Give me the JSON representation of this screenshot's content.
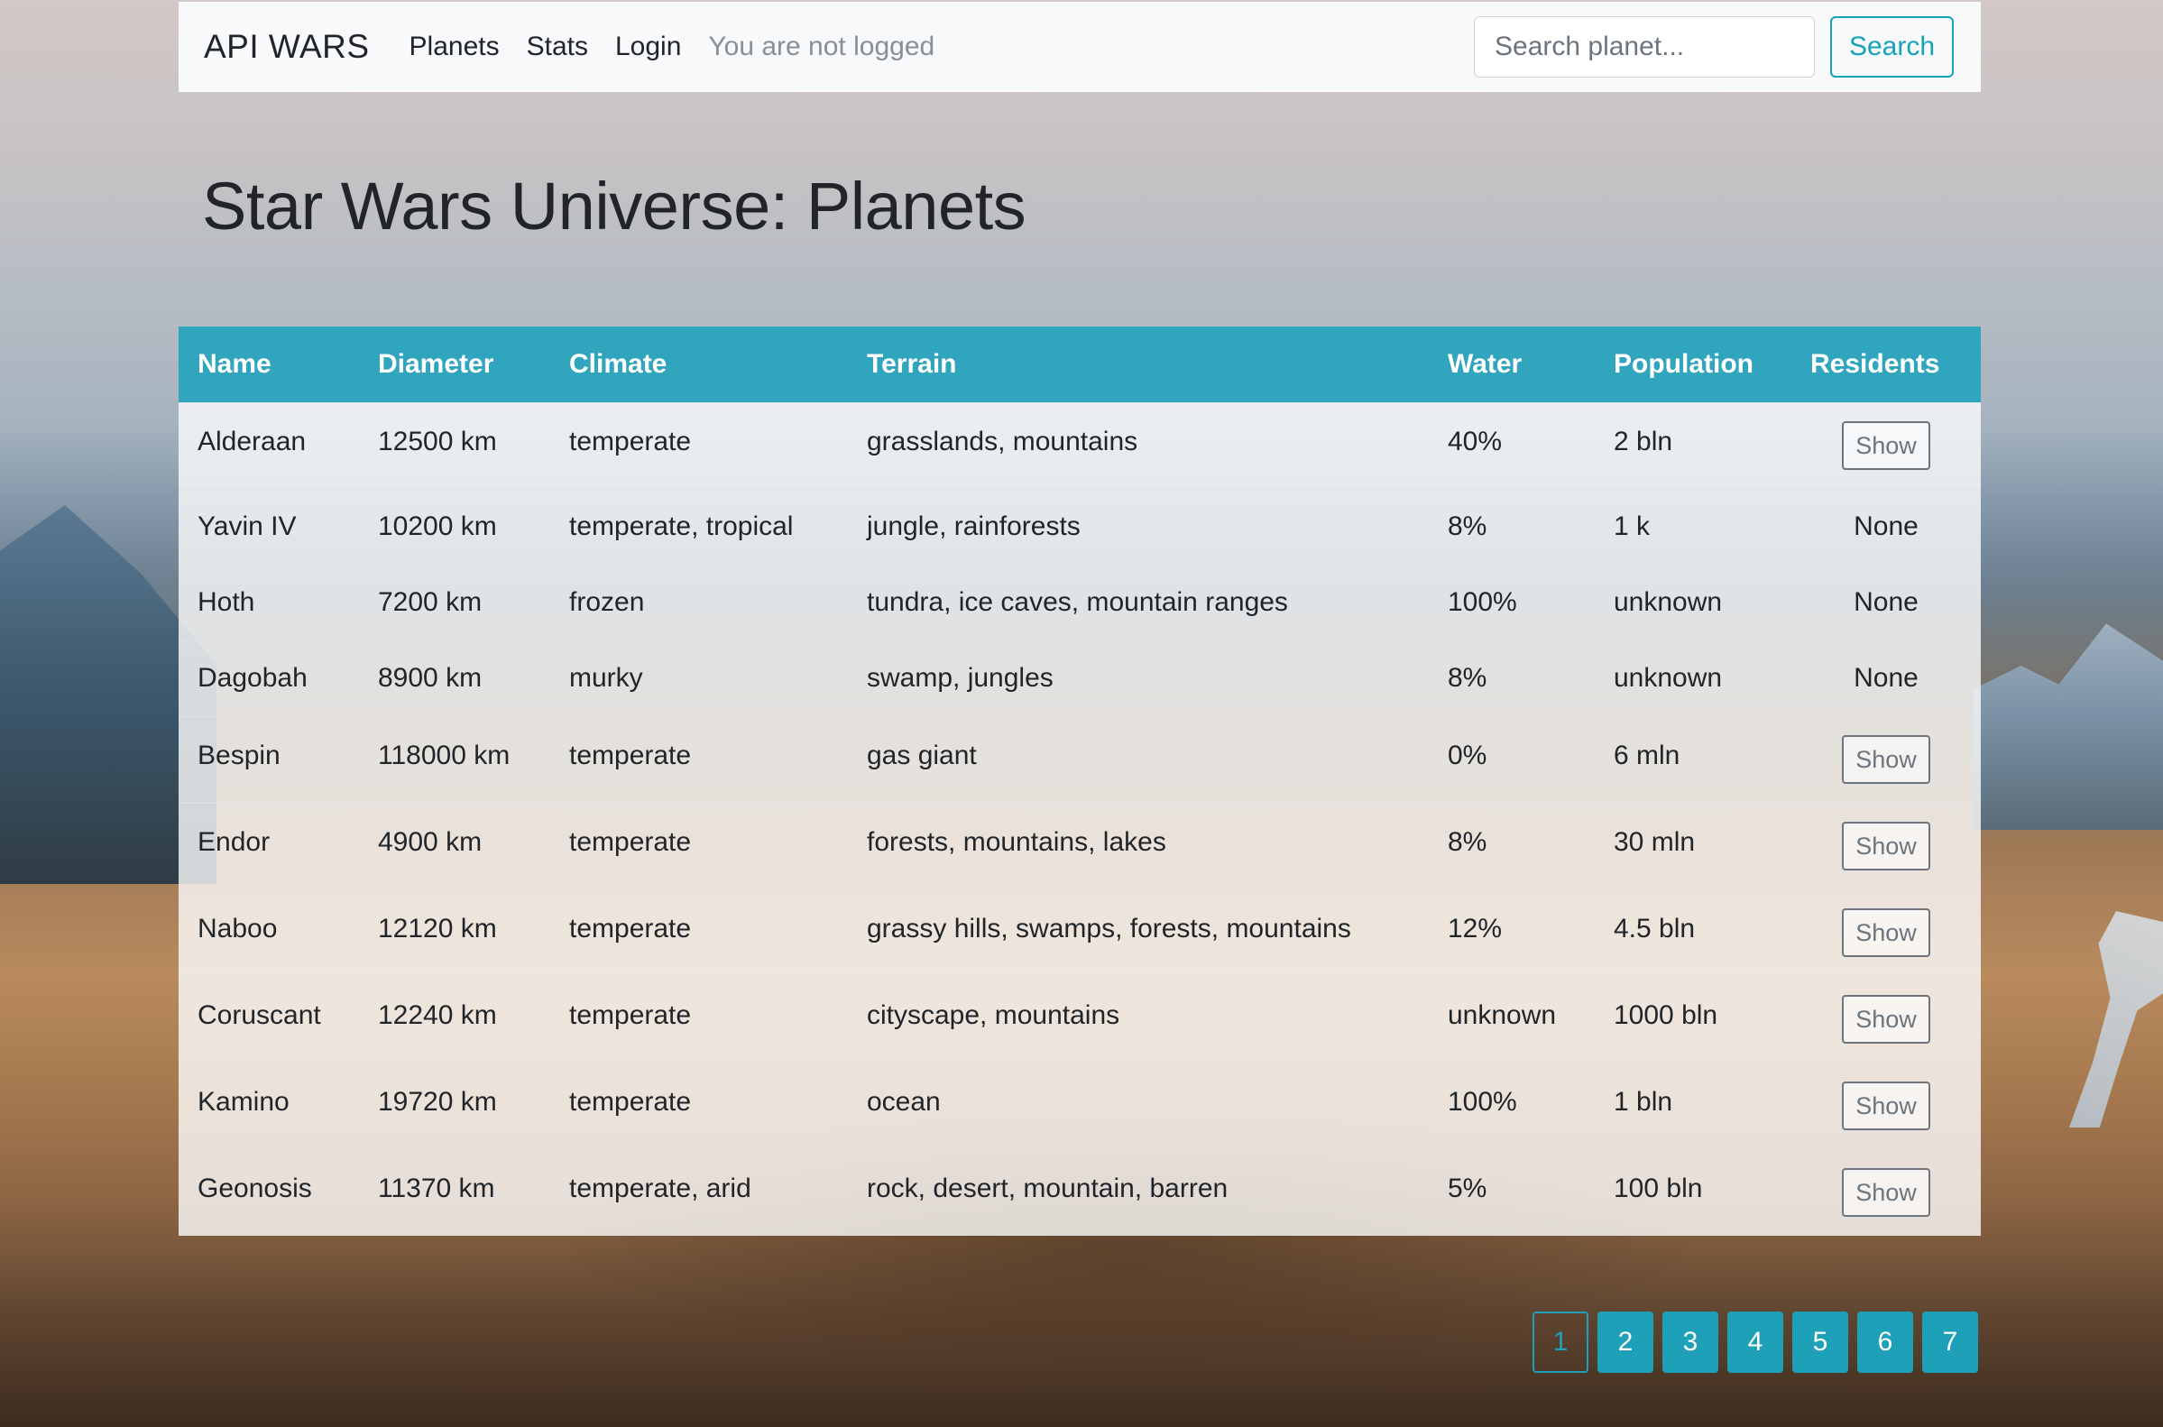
{
  "navbar": {
    "brand": "API WARS",
    "links": [
      "Planets",
      "Stats",
      "Login"
    ],
    "status_text": "You are not logged",
    "search_placeholder": "Search planet...",
    "search_button": "Search"
  },
  "page_title": "Star Wars Universe: Planets",
  "table": {
    "headers": [
      "Name",
      "Diameter",
      "Climate",
      "Terrain",
      "Water",
      "Population",
      "Residents"
    ],
    "rows": [
      {
        "name": "Alderaan",
        "diameter": "12500 km",
        "climate": "temperate",
        "terrain": "grasslands, mountains",
        "water": "40%",
        "population": "2 bln",
        "residents": "Show"
      },
      {
        "name": "Yavin IV",
        "diameter": "10200 km",
        "climate": "temperate, tropical",
        "terrain": "jungle, rainforests",
        "water": "8%",
        "population": "1 k",
        "residents": "None"
      },
      {
        "name": "Hoth",
        "diameter": "7200 km",
        "climate": "frozen",
        "terrain": "tundra, ice caves, mountain ranges",
        "water": "100%",
        "population": "unknown",
        "residents": "None"
      },
      {
        "name": "Dagobah",
        "diameter": "8900 km",
        "climate": "murky",
        "terrain": "swamp, jungles",
        "water": "8%",
        "population": "unknown",
        "residents": "None"
      },
      {
        "name": "Bespin",
        "diameter": "118000 km",
        "climate": "temperate",
        "terrain": "gas giant",
        "water": "0%",
        "population": "6 mln",
        "residents": "Show"
      },
      {
        "name": "Endor",
        "diameter": "4900 km",
        "climate": "temperate",
        "terrain": "forests, mountains, lakes",
        "water": "8%",
        "population": "30 mln",
        "residents": "Show"
      },
      {
        "name": "Naboo",
        "diameter": "12120 km",
        "climate": "temperate",
        "terrain": "grassy hills, swamps, forests, mountains",
        "water": "12%",
        "population": "4.5 bln",
        "residents": "Show"
      },
      {
        "name": "Coruscant",
        "diameter": "12240 km",
        "climate": "temperate",
        "terrain": "cityscape, mountains",
        "water": "unknown",
        "population": "1000 bln",
        "residents": "Show"
      },
      {
        "name": "Kamino",
        "diameter": "19720 km",
        "climate": "temperate",
        "terrain": "ocean",
        "water": "100%",
        "population": "1 bln",
        "residents": "Show"
      },
      {
        "name": "Geonosis",
        "diameter": "11370 km",
        "climate": "temperate, arid",
        "terrain": "rock, desert, mountain, barren",
        "water": "5%",
        "population": "100 bln",
        "residents": "Show"
      }
    ]
  },
  "pagination": {
    "pages": [
      "1",
      "2",
      "3",
      "4",
      "5",
      "6",
      "7"
    ],
    "active": "1"
  },
  "colors": {
    "accent": "#17a2b8",
    "table_header": "#30a5bd"
  }
}
